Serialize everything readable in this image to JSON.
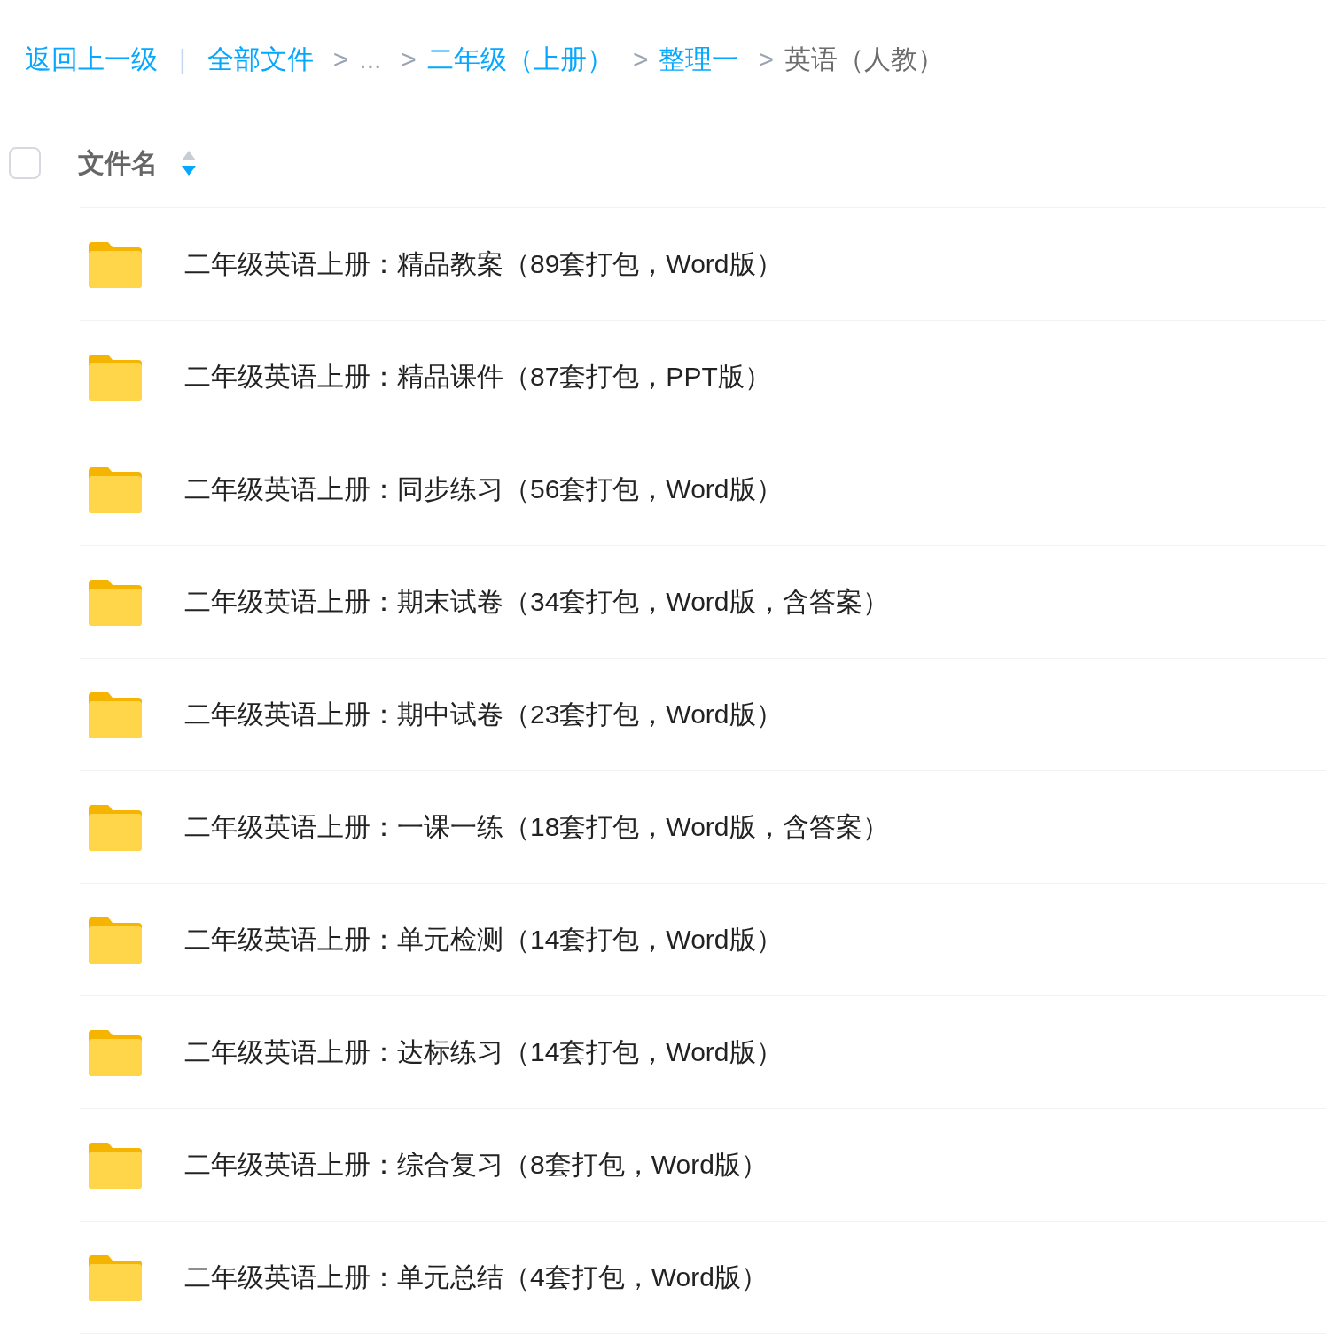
{
  "breadcrumb": [
    {
      "kind": "link",
      "text": "返回上一级"
    },
    {
      "kind": "divider",
      "text": "|"
    },
    {
      "kind": "link",
      "text": "全部文件"
    },
    {
      "kind": "separator",
      "text": ">"
    },
    {
      "kind": "ellipsis",
      "text": "..."
    },
    {
      "kind": "separator",
      "text": ">"
    },
    {
      "kind": "link",
      "text": "二年级（上册）"
    },
    {
      "kind": "separator",
      "text": ">"
    },
    {
      "kind": "link",
      "text": "整理一"
    },
    {
      "kind": "separator",
      "text": ">"
    },
    {
      "kind": "current",
      "text": "英语（人教）"
    }
  ],
  "header": {
    "checked": false,
    "column": "文件名",
    "sort_descending": true
  },
  "files": [
    {
      "name": "二年级英语上册：精品教案（89套打包，Word版）"
    },
    {
      "name": "二年级英语上册：精品课件（87套打包，PPT版）"
    },
    {
      "name": "二年级英语上册：同步练习（56套打包，Word版）"
    },
    {
      "name": "二年级英语上册：期末试卷（34套打包，Word版，含答案）"
    },
    {
      "name": "二年级英语上册：期中试卷（23套打包，Word版）"
    },
    {
      "name": "二年级英语上册：一课一练（18套打包，Word版，含答案）"
    },
    {
      "name": "二年级英语上册：单元检测（14套打包，Word版）"
    },
    {
      "name": "二年级英语上册：达标练习（14套打包，Word版）"
    },
    {
      "name": "二年级英语上册：综合复习（8套打包，Word版）"
    },
    {
      "name": "二年级英语上册：单元总结（4套打包，Word版）"
    }
  ]
}
